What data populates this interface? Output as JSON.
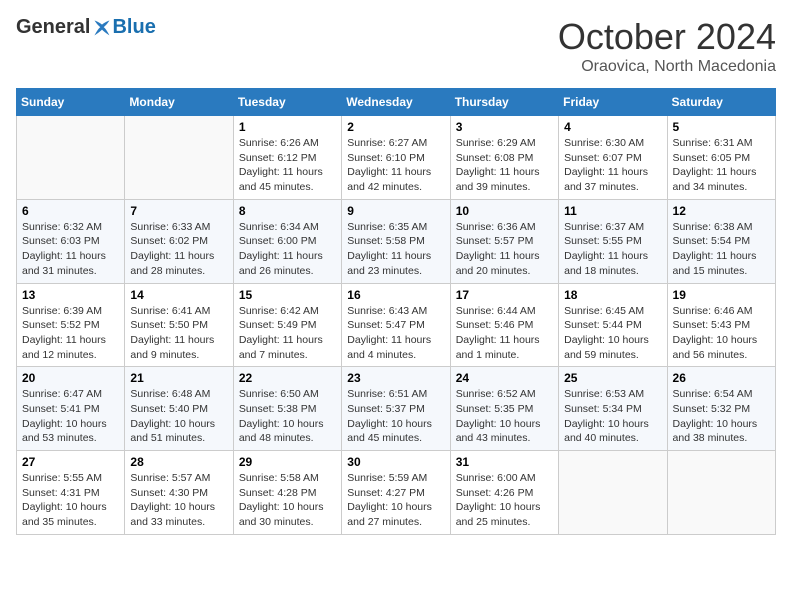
{
  "header": {
    "logo_general": "General",
    "logo_blue": "Blue",
    "month_title": "October 2024",
    "subtitle": "Oraovica, North Macedonia"
  },
  "weekdays": [
    "Sunday",
    "Monday",
    "Tuesday",
    "Wednesday",
    "Thursday",
    "Friday",
    "Saturday"
  ],
  "weeks": [
    [
      {
        "day": "",
        "sunrise": "",
        "sunset": "",
        "daylight": ""
      },
      {
        "day": "",
        "sunrise": "",
        "sunset": "",
        "daylight": ""
      },
      {
        "day": "1",
        "sunrise": "Sunrise: 6:26 AM",
        "sunset": "Sunset: 6:12 PM",
        "daylight": "Daylight: 11 hours and 45 minutes."
      },
      {
        "day": "2",
        "sunrise": "Sunrise: 6:27 AM",
        "sunset": "Sunset: 6:10 PM",
        "daylight": "Daylight: 11 hours and 42 minutes."
      },
      {
        "day": "3",
        "sunrise": "Sunrise: 6:29 AM",
        "sunset": "Sunset: 6:08 PM",
        "daylight": "Daylight: 11 hours and 39 minutes."
      },
      {
        "day": "4",
        "sunrise": "Sunrise: 6:30 AM",
        "sunset": "Sunset: 6:07 PM",
        "daylight": "Daylight: 11 hours and 37 minutes."
      },
      {
        "day": "5",
        "sunrise": "Sunrise: 6:31 AM",
        "sunset": "Sunset: 6:05 PM",
        "daylight": "Daylight: 11 hours and 34 minutes."
      }
    ],
    [
      {
        "day": "6",
        "sunrise": "Sunrise: 6:32 AM",
        "sunset": "Sunset: 6:03 PM",
        "daylight": "Daylight: 11 hours and 31 minutes."
      },
      {
        "day": "7",
        "sunrise": "Sunrise: 6:33 AM",
        "sunset": "Sunset: 6:02 PM",
        "daylight": "Daylight: 11 hours and 28 minutes."
      },
      {
        "day": "8",
        "sunrise": "Sunrise: 6:34 AM",
        "sunset": "Sunset: 6:00 PM",
        "daylight": "Daylight: 11 hours and 26 minutes."
      },
      {
        "day": "9",
        "sunrise": "Sunrise: 6:35 AM",
        "sunset": "Sunset: 5:58 PM",
        "daylight": "Daylight: 11 hours and 23 minutes."
      },
      {
        "day": "10",
        "sunrise": "Sunrise: 6:36 AM",
        "sunset": "Sunset: 5:57 PM",
        "daylight": "Daylight: 11 hours and 20 minutes."
      },
      {
        "day": "11",
        "sunrise": "Sunrise: 6:37 AM",
        "sunset": "Sunset: 5:55 PM",
        "daylight": "Daylight: 11 hours and 18 minutes."
      },
      {
        "day": "12",
        "sunrise": "Sunrise: 6:38 AM",
        "sunset": "Sunset: 5:54 PM",
        "daylight": "Daylight: 11 hours and 15 minutes."
      }
    ],
    [
      {
        "day": "13",
        "sunrise": "Sunrise: 6:39 AM",
        "sunset": "Sunset: 5:52 PM",
        "daylight": "Daylight: 11 hours and 12 minutes."
      },
      {
        "day": "14",
        "sunrise": "Sunrise: 6:41 AM",
        "sunset": "Sunset: 5:50 PM",
        "daylight": "Daylight: 11 hours and 9 minutes."
      },
      {
        "day": "15",
        "sunrise": "Sunrise: 6:42 AM",
        "sunset": "Sunset: 5:49 PM",
        "daylight": "Daylight: 11 hours and 7 minutes."
      },
      {
        "day": "16",
        "sunrise": "Sunrise: 6:43 AM",
        "sunset": "Sunset: 5:47 PM",
        "daylight": "Daylight: 11 hours and 4 minutes."
      },
      {
        "day": "17",
        "sunrise": "Sunrise: 6:44 AM",
        "sunset": "Sunset: 5:46 PM",
        "daylight": "Daylight: 11 hours and 1 minute."
      },
      {
        "day": "18",
        "sunrise": "Sunrise: 6:45 AM",
        "sunset": "Sunset: 5:44 PM",
        "daylight": "Daylight: 10 hours and 59 minutes."
      },
      {
        "day": "19",
        "sunrise": "Sunrise: 6:46 AM",
        "sunset": "Sunset: 5:43 PM",
        "daylight": "Daylight: 10 hours and 56 minutes."
      }
    ],
    [
      {
        "day": "20",
        "sunrise": "Sunrise: 6:47 AM",
        "sunset": "Sunset: 5:41 PM",
        "daylight": "Daylight: 10 hours and 53 minutes."
      },
      {
        "day": "21",
        "sunrise": "Sunrise: 6:48 AM",
        "sunset": "Sunset: 5:40 PM",
        "daylight": "Daylight: 10 hours and 51 minutes."
      },
      {
        "day": "22",
        "sunrise": "Sunrise: 6:50 AM",
        "sunset": "Sunset: 5:38 PM",
        "daylight": "Daylight: 10 hours and 48 minutes."
      },
      {
        "day": "23",
        "sunrise": "Sunrise: 6:51 AM",
        "sunset": "Sunset: 5:37 PM",
        "daylight": "Daylight: 10 hours and 45 minutes."
      },
      {
        "day": "24",
        "sunrise": "Sunrise: 6:52 AM",
        "sunset": "Sunset: 5:35 PM",
        "daylight": "Daylight: 10 hours and 43 minutes."
      },
      {
        "day": "25",
        "sunrise": "Sunrise: 6:53 AM",
        "sunset": "Sunset: 5:34 PM",
        "daylight": "Daylight: 10 hours and 40 minutes."
      },
      {
        "day": "26",
        "sunrise": "Sunrise: 6:54 AM",
        "sunset": "Sunset: 5:32 PM",
        "daylight": "Daylight: 10 hours and 38 minutes."
      }
    ],
    [
      {
        "day": "27",
        "sunrise": "Sunrise: 5:55 AM",
        "sunset": "Sunset: 4:31 PM",
        "daylight": "Daylight: 10 hours and 35 minutes."
      },
      {
        "day": "28",
        "sunrise": "Sunrise: 5:57 AM",
        "sunset": "Sunset: 4:30 PM",
        "daylight": "Daylight: 10 hours and 33 minutes."
      },
      {
        "day": "29",
        "sunrise": "Sunrise: 5:58 AM",
        "sunset": "Sunset: 4:28 PM",
        "daylight": "Daylight: 10 hours and 30 minutes."
      },
      {
        "day": "30",
        "sunrise": "Sunrise: 5:59 AM",
        "sunset": "Sunset: 4:27 PM",
        "daylight": "Daylight: 10 hours and 27 minutes."
      },
      {
        "day": "31",
        "sunrise": "Sunrise: 6:00 AM",
        "sunset": "Sunset: 4:26 PM",
        "daylight": "Daylight: 10 hours and 25 minutes."
      },
      {
        "day": "",
        "sunrise": "",
        "sunset": "",
        "daylight": ""
      },
      {
        "day": "",
        "sunrise": "",
        "sunset": "",
        "daylight": ""
      }
    ]
  ]
}
